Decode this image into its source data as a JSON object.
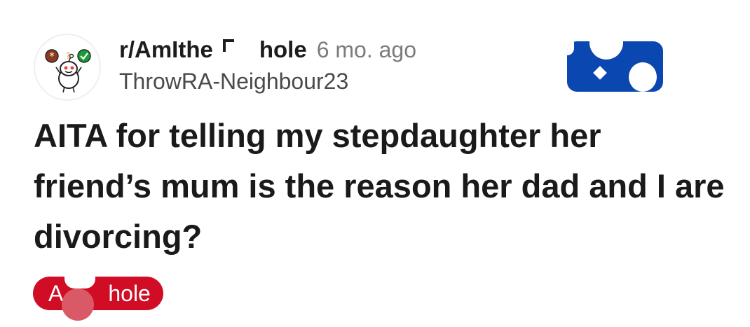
{
  "post": {
    "subreddit": "r/AmIthe        hole",
    "time_ago": "6 mo. ago",
    "author": "ThrowRA-Neighbour23",
    "title": "AITA for telling my stepdaughter her friend’s mum is the reason her dad and I are divorcing?",
    "flair": "A        hole"
  },
  "icons": {
    "avatar": "reddit-snoo-icon",
    "join": "join-button"
  },
  "colors": {
    "join_bg": "#0a47b0",
    "flair_bg": "#d00d24"
  }
}
